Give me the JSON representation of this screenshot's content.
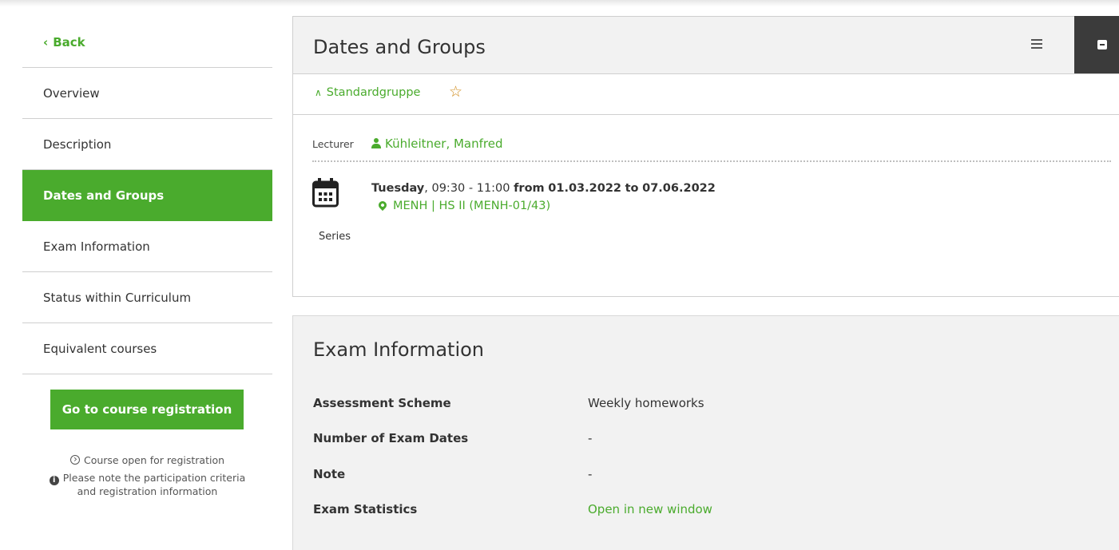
{
  "sidebar": {
    "back": "Back",
    "items": [
      "Overview",
      "Description",
      "Dates and Groups",
      "Exam Information",
      "Status within Curriculum",
      "Equivalent courses"
    ],
    "active_index": 2,
    "register_button": "Go to course registration",
    "open_text": "Course open for registration",
    "note_line1": "Please note the participation criteria",
    "note_line2": "and registration information"
  },
  "dates": {
    "title": "Dates and Groups",
    "group": "Standardgruppe",
    "lecturer_label": "Lecturer",
    "lecturer": "Kühleitner, Manfred",
    "day": "Tuesday",
    "time": ", 09:30 - 11:00",
    "from_label": "from",
    "start": "01.03.2022",
    "to_label": "to",
    "end": "07.06.2022",
    "location": "MENH | HS II (MENH-01/43)",
    "series_label": "Series"
  },
  "exam": {
    "title": "Exam Information",
    "rows": [
      {
        "label": "Assessment Scheme",
        "value": "Weekly homeworks"
      },
      {
        "label": "Number of Exam Dates",
        "value": "-"
      },
      {
        "label": "Note",
        "value": "-"
      },
      {
        "label": "Exam Statistics",
        "value": "Open in new window"
      }
    ]
  },
  "colors": {
    "accent": "#4aab2d",
    "dark": "#3b3b3b",
    "star": "#d08b1a"
  }
}
